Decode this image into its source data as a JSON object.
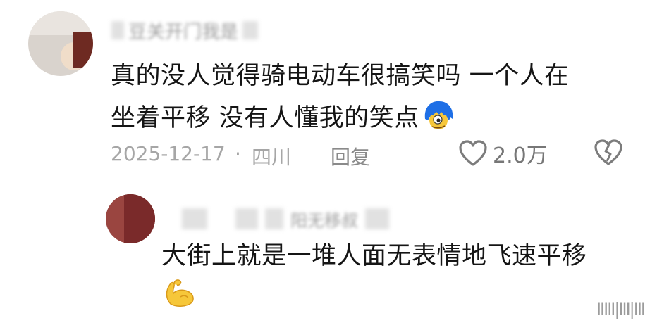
{
  "comment": {
    "username": "豆关开门我是",
    "text_line1": "真的没人觉得骑电动车很搞笑吗 一个人在",
    "text_line2": "坐着平移 没有人懂我的笑点",
    "date": "2025-12-17",
    "separator": "·",
    "location": "四川",
    "reply_label": "回复",
    "likes": "2.0万",
    "emoji_icon": "blue-hair-face-emoji"
  },
  "reply": {
    "username": "阳无移叔",
    "text": "大街上就是一堆人面无表情地飞速平移",
    "emoji_icon": "flexed-biceps-emoji"
  },
  "watermark": "IIIII|III|III",
  "colors": {
    "text": "#151515",
    "meta": "#a6a6a6",
    "icon": "#888888",
    "emoji_yellow": "#f6c73a",
    "emoji_blue": "#1e6fe6"
  }
}
